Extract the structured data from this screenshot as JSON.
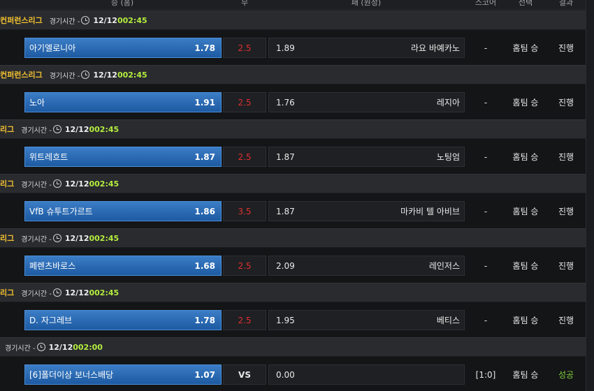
{
  "header": {
    "home": "승 (홈)",
    "draw": "무",
    "away": "패 (원정)",
    "score": "스코어",
    "pick": "선택",
    "result": "결과"
  },
  "time_prefix": "경기시간 -",
  "groups": [
    {
      "league": "컨퍼런스리그",
      "date": "12/12",
      "time": "002:45",
      "home_team": "아기엘로니아",
      "home_odd": "1.78",
      "draw": "2.5",
      "away_odd": "1.89",
      "away_team": "라요 바예카노",
      "score": "-",
      "pick": "홈팀 승",
      "result": "진행"
    },
    {
      "league": "컨퍼런스리그",
      "date": "12/12",
      "time": "002:45",
      "home_team": "노아",
      "home_odd": "1.91",
      "draw": "2.5",
      "away_odd": "1.76",
      "away_team": "레지아",
      "score": "-",
      "pick": "홈팀 승",
      "result": "진행"
    },
    {
      "league": "리그",
      "date": "12/12",
      "time": "002:45",
      "home_team": "위트레흐트",
      "home_odd": "1.87",
      "draw": "2.5",
      "away_odd": "1.87",
      "away_team": "노팅엄",
      "score": "-",
      "pick": "홈팀 승",
      "result": "진행"
    },
    {
      "league": "리그",
      "date": "12/12",
      "time": "002:45",
      "home_team": "VfB 슈투트가르트",
      "home_odd": "1.86",
      "draw": "3.5",
      "away_odd": "1.87",
      "away_team": "마카비 텔 아비브",
      "score": "-",
      "pick": "홈팀 승",
      "result": "진행"
    },
    {
      "league": "리그",
      "date": "12/12",
      "time": "002:45",
      "home_team": "페렌츠바로스",
      "home_odd": "1.68",
      "draw": "2.5",
      "away_odd": "2.09",
      "away_team": "레인저스",
      "score": "-",
      "pick": "홈팀 승",
      "result": "진행"
    },
    {
      "league": "리그",
      "date": "12/12",
      "time": "002:45",
      "home_team": "D. 자그레브",
      "home_odd": "1.78",
      "draw": "2.5",
      "away_odd": "1.95",
      "away_team": "베티스",
      "score": "-",
      "pick": "홈팀 승",
      "result": "진행"
    },
    {
      "league": "",
      "date": "12/12",
      "time": "002:00",
      "home_team": "[6]폴더이상 보너스배당",
      "home_odd": "1.07",
      "draw": "VS",
      "away_odd": "0.00",
      "away_team": "",
      "score": "[1:0]",
      "pick": "홈팀 승",
      "result": "성공"
    }
  ],
  "colors": {
    "league": "#f2c230",
    "time": "#b4ee3e",
    "home_cell": "#2a6bb5",
    "draw_odd": "#e03030",
    "success": "#7fd13b"
  },
  "icons": {
    "clock": "clock-icon"
  }
}
